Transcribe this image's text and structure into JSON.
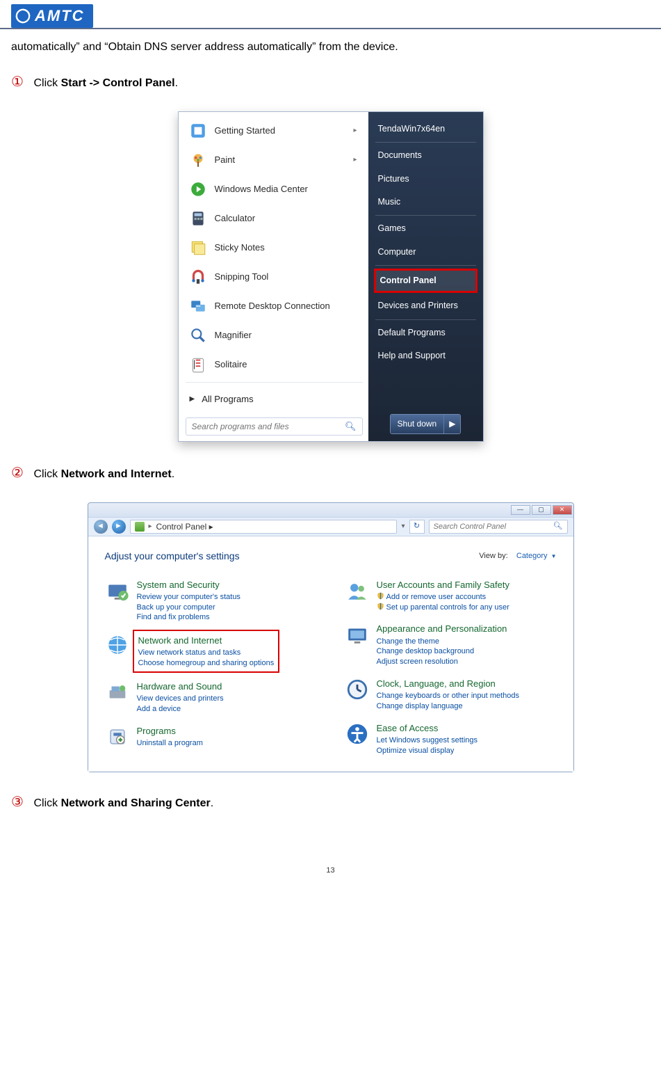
{
  "logo_text": "AMTC",
  "intro_line": "automatically” and “Obtain DNS server address automatically” from the device.",
  "steps": {
    "s1_num": "①",
    "s1_pre": "Click ",
    "s1_bold": "Start -> Control Panel",
    "s1_post": ".",
    "s2_num": "②",
    "s2_pre": "Click ",
    "s2_bold": "Network and Internet",
    "s2_post": ".",
    "s3_num": "③",
    "s3_pre": "Click ",
    "s3_bold": "Network and Sharing Center",
    "s3_post": "."
  },
  "startmenu": {
    "left_items": [
      {
        "label": "Getting Started",
        "arrow": true
      },
      {
        "label": "Paint",
        "arrow": true
      },
      {
        "label": "Windows Media Center",
        "arrow": false
      },
      {
        "label": "Calculator",
        "arrow": false
      },
      {
        "label": "Sticky Notes",
        "arrow": false
      },
      {
        "label": "Snipping Tool",
        "arrow": false
      },
      {
        "label": "Remote Desktop Connection",
        "arrow": false
      },
      {
        "label": "Magnifier",
        "arrow": false
      },
      {
        "label": "Solitaire",
        "arrow": false
      }
    ],
    "all_programs": "All Programs",
    "search_placeholder": "Search programs and files",
    "right_items": [
      {
        "label": "TendaWin7x64en"
      },
      {
        "label": "Documents"
      },
      {
        "label": "Pictures"
      },
      {
        "label": "Music"
      },
      {
        "label": "Games"
      },
      {
        "label": "Computer"
      },
      {
        "label": "Control Panel",
        "highlight": true
      },
      {
        "label": "Devices and Printers"
      },
      {
        "label": "Default Programs"
      },
      {
        "label": "Help and Support"
      }
    ],
    "shutdown": "Shut down"
  },
  "cpwindow": {
    "breadcrumb": "Control Panel  ▸",
    "search_placeholder": "Search Control Panel",
    "adjust_title": "Adjust your computer's settings",
    "viewby_label": "View by:",
    "viewby_value": "Category",
    "left_col": [
      {
        "title": "System and Security",
        "links": [
          "Review your computer's status",
          "Back up your computer",
          "Find and fix problems"
        ]
      },
      {
        "title": "Network and Internet",
        "links": [
          "View network status and tasks",
          "Choose homegroup and sharing options"
        ],
        "highlight": true
      },
      {
        "title": "Hardware and Sound",
        "links": [
          "View devices and printers",
          "Add a device"
        ]
      },
      {
        "title": "Programs",
        "links": [
          "Uninstall a program"
        ]
      }
    ],
    "right_col": [
      {
        "title": "User Accounts and Family Safety",
        "links": [
          "Add or remove user accounts",
          "Set up parental controls for any user"
        ],
        "badged": true
      },
      {
        "title": "Appearance and Personalization",
        "links": [
          "Change the theme",
          "Change desktop background",
          "Adjust screen resolution"
        ]
      },
      {
        "title": "Clock, Language, and Region",
        "links": [
          "Change keyboards or other input methods",
          "Change display language"
        ]
      },
      {
        "title": "Ease of Access",
        "links": [
          "Let Windows suggest settings",
          "Optimize visual display"
        ]
      }
    ]
  },
  "page_number": "13"
}
